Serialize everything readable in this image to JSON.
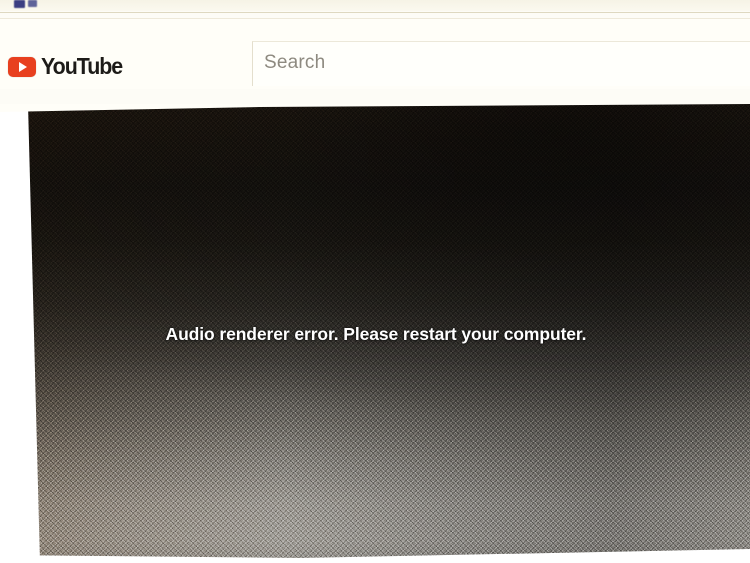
{
  "browser": {
    "tab_favicon_icon": "tab-favicon-icon"
  },
  "masthead": {
    "logo": {
      "icon": "youtube-play-icon",
      "wordmark": "YouTube"
    },
    "search": {
      "placeholder": "Search",
      "value": ""
    }
  },
  "player": {
    "error_message": "Audio renderer error. Please restart your computer.",
    "state": "error"
  },
  "colors": {
    "youtube_red": "#e8401f",
    "page_background": "#fffef8",
    "search_placeholder": "#8e8a80",
    "error_text": "#ffffff",
    "tab_favicon": "#2b2f7a"
  }
}
